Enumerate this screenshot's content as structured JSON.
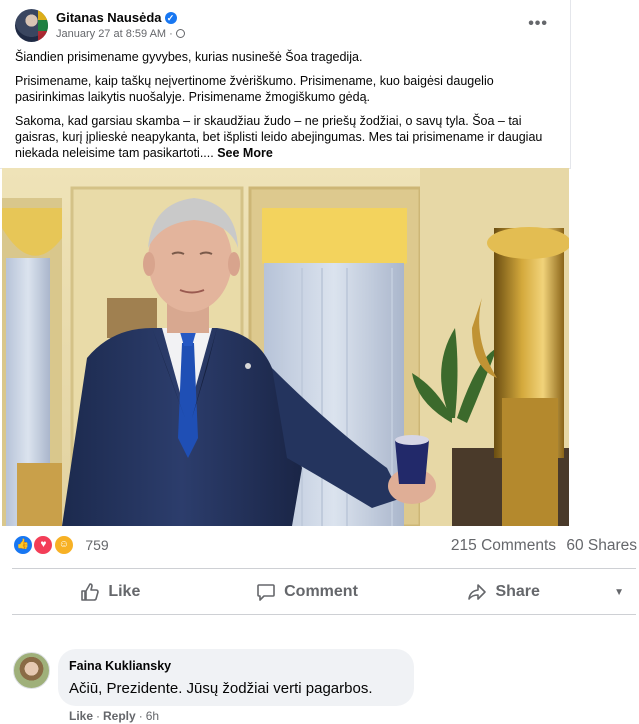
{
  "post": {
    "author": "Gitanas Nausėda",
    "date": "January 27 at 8:59 AM",
    "paragraphs": [
      "Šiandien prisimename gyvybes, kurias nusinešė Šoa tragedija.",
      "Prisimename, kaip taškų neįvertinome žvėriškumo. Prisimename, kuo baigėsi daugelio pasirinkimas laikytis nuošalyje. Prisimename žmogiškumo gėdą.",
      "Sakoma, kad garsiau skamba – ir skaudžiau žudo – ne priešų žodžiai, o savų tyla. Šoa – tai gaisras, kurį įplieskė neapykanta, bet išplisti leido abejingumas. Mes tai prisimename ir daugiau niekada neleisime tam pasikartoti...."
    ],
    "see_more": "See More"
  },
  "reactions": {
    "count": "759",
    "comments": "215 Comments",
    "shares": "60 Shares"
  },
  "actions": {
    "like": "Like",
    "comment": "Comment",
    "share": "Share"
  },
  "comment": {
    "author": "Faina Kukliansky",
    "text": "Ačiū, Prezidente. Jūsų žodžiai verti pagarbos.",
    "like": "Like",
    "reply": "Reply",
    "time": "6h"
  },
  "colors": {
    "facebook_blue": "#1877f2",
    "love_red": "#f33e58",
    "care_yellow": "#f7b125",
    "muted_text": "#65676b"
  }
}
